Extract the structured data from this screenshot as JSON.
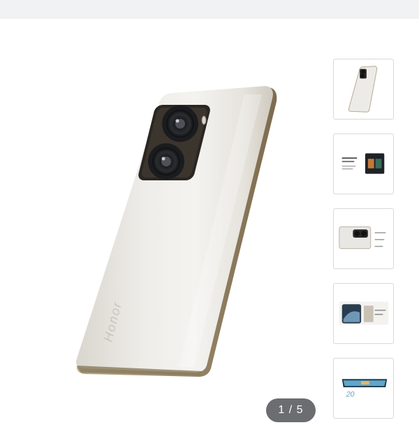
{
  "gallery": {
    "counter": {
      "current": "1",
      "separator": "/",
      "total": "5",
      "text": "1 / 5"
    },
    "main_image": {
      "icon": "phone-back-white-image",
      "brand_text": "Honor"
    },
    "thumbnails": [
      {
        "name": "thumbnail-phone-back",
        "selected": true
      },
      {
        "name": "thumbnail-spec-sheet",
        "selected": false
      },
      {
        "name": "thumbnail-camera-detail",
        "selected": false
      },
      {
        "name": "thumbnail-phone-screen",
        "selected": false
      },
      {
        "name": "thumbnail-phone-front",
        "selected": false
      }
    ]
  },
  "colors": {
    "topbar": "#f1f2f4",
    "counter_bg": "#6b6d70",
    "thumb_border": "#d6d8dc"
  }
}
